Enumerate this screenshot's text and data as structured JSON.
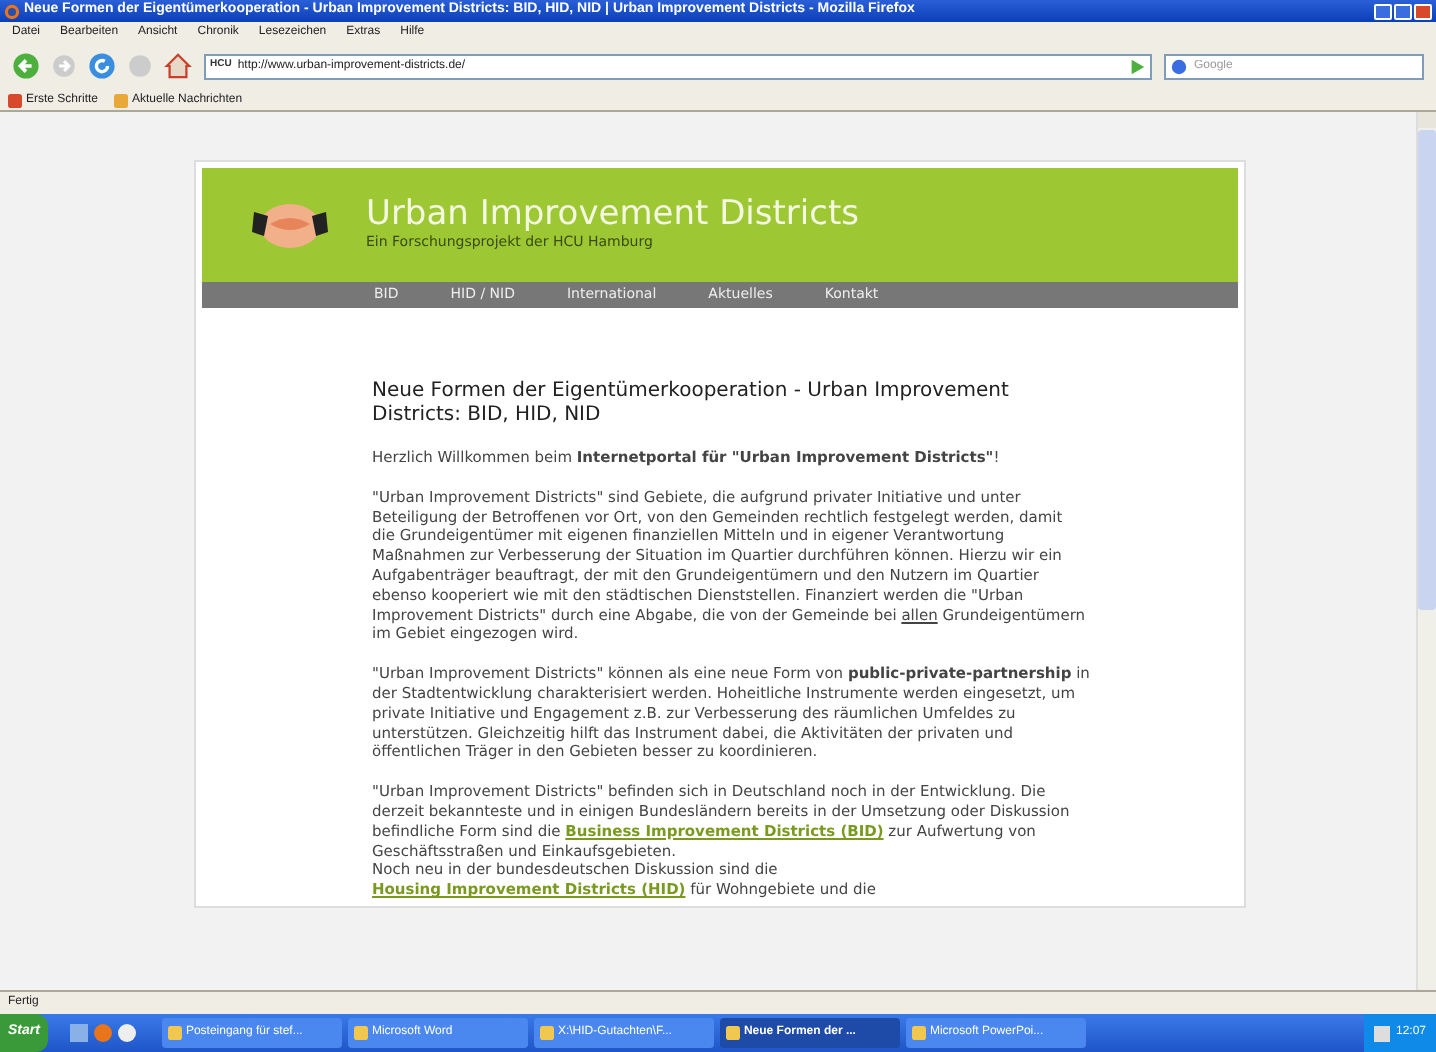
{
  "window": {
    "title": "Neue Formen der Eigentümerkooperation - Urban Improvement Districts: BID, HID, NID | Urban Improvement Districts - Mozilla Firefox"
  },
  "menu": [
    "Datei",
    "Bearbeiten",
    "Ansicht",
    "Chronik",
    "Lesezeichen",
    "Extras",
    "Hilfe"
  ],
  "address_bar": {
    "site_label": "HCU",
    "url": "http://www.urban-improvement-districts.de/"
  },
  "search": {
    "placeholder": "Google"
  },
  "bookmarks": [
    "Erste Schritte",
    "Aktuelle Nachrichten"
  ],
  "site": {
    "title": "Urban Improvement Districts",
    "subtitle": "Ein Forschungsprojekt der HCU Hamburg",
    "nav": [
      "BID",
      "HID / NID",
      "International",
      "Aktuelles",
      "Kontakt"
    ],
    "heading": "Neue Formen der Eigentümerkooperation - Urban Improvement Districts: BID, HID, NID",
    "paragraphs": [
      [
        {
          "kind": "text",
          "text": "Herzlich Willkommen beim **Internetportal für \"Urban Improvement Districts\"**!"
        }
      ],
      [
        {
          "kind": "text",
          "text": "\"Urban Improvement Districts\" sind Gebiete, die aufgrund privater Initiative und unter Beteiligung der Betroffenen vor Ort, von den Gemeinden rechtlich festgelegt werden, damit die Grundeigentümer mit eigenen finanziellen Mitteln und in eigener Verantwortung Maßnahmen zur Verbesserung der Situation im Quartier durchführen können. Hierzu wir ein Aufgabenträger beauftragt, der mit den Grundeigentümern und den Nutzern im Quartier ebenso kooperiert wie mit den städtischen Dienststellen. Finanziert werden die \"Urban Improvement Districts\" durch eine Abgabe, die von der Gemeinde bei "
        },
        {
          "kind": "underline",
          "text": "allen"
        },
        {
          "kind": "text",
          "text": " Grundeigentümern im Gebiet eingezogen wird."
        }
      ],
      [
        {
          "kind": "text",
          "text": "\"Urban Improvement Districts\" können als eine neue Form von **public-private-partnership** in der Stadtentwicklung charakterisiert werden. Hoheitliche Instrumente werden eingesetzt, um private Initiative und Engagement z.B. zur Verbesserung des räumlichen Umfeldes zu unterstützen. Gleichzeitig hilft das Instrument dabei, die Aktivitäten der privaten und öffentlichen Träger in den Gebieten besser zu koordinieren."
        }
      ],
      [
        {
          "kind": "text",
          "text": "\"Urban Improvement Districts\" befinden sich in Deutschland noch in der Entwicklung. Die derzeit bekannteste und in einigen Bundesländern bereits in der Umsetzung oder Diskussion befindliche Form sind die "
        },
        {
          "kind": "link",
          "text": "Business Improvement Districts (BID)"
        },
        {
          "kind": "text",
          "text": " zur Aufwertung von Geschäftsstraßen und Einkaufsgebieten."
        },
        {
          "kind": "break"
        },
        {
          "kind": "text",
          "text": "Noch neu in der bundesdeutschen Diskussion sind die"
        },
        {
          "kind": "break"
        },
        {
          "kind": "link",
          "text": "Housing Improvement Districts (HID)"
        },
        {
          "kind": "text",
          "text": " für Wohngebiete und die"
        }
      ]
    ]
  },
  "status_bar": "Fertig",
  "taskbar": {
    "start": "Start",
    "items": [
      {
        "label": "Posteingang für stef...",
        "selected": false
      },
      {
        "label": "Microsoft Word",
        "selected": false
      },
      {
        "label": "X:\\HID-Gutachten\\F...",
        "selected": false
      },
      {
        "label": "Neue Formen der ...",
        "selected": true
      },
      {
        "label": "Microsoft PowerPoi...",
        "selected": false
      }
    ],
    "clock": "12:07"
  }
}
